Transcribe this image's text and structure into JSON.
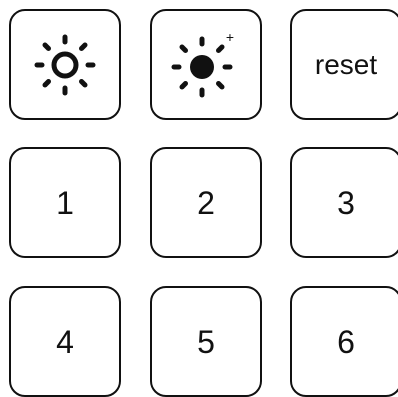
{
  "keypad": {
    "row1": {
      "brightness_down": {
        "icon": "brightness-outline-icon"
      },
      "brightness_up": {
        "icon": "brightness-up-filled-icon",
        "badge": "+"
      },
      "reset": {
        "label": "reset"
      }
    },
    "digits": [
      "1",
      "2",
      "3",
      "4",
      "5",
      "6"
    ]
  }
}
